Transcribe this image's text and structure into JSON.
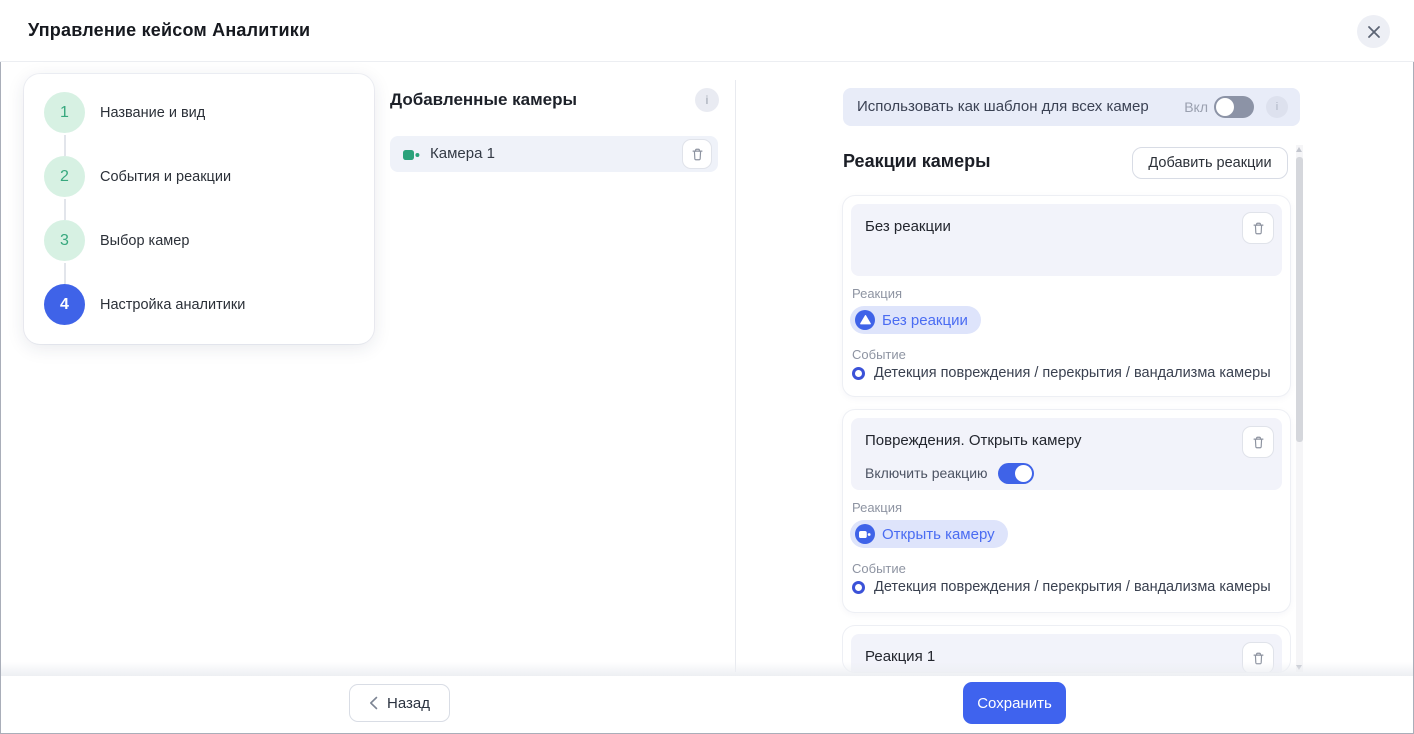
{
  "window": {
    "title": "Управление кейсом Аналитики",
    "close_icon": "close-x"
  },
  "stepper": {
    "steps": [
      {
        "number": "1",
        "label": "Название и вид",
        "state": "done"
      },
      {
        "number": "2",
        "label": "События и реакции",
        "state": "done"
      },
      {
        "number": "3",
        "label": "Выбор камер",
        "state": "done"
      },
      {
        "number": "4",
        "label": "Настройка аналитики",
        "state": "active"
      }
    ]
  },
  "cameras_panel": {
    "title": "Добавленные камеры",
    "info_icon": "i",
    "items": [
      {
        "name": "Камера 1",
        "icon": "camera-green"
      }
    ]
  },
  "reactions_panel": {
    "template_banner": {
      "label": "Использовать как шаблон для всех камер",
      "toggle_label": "Вкл",
      "toggle_state": "off",
      "info_icon": "i"
    },
    "title": "Реакции камеры",
    "add_button": "Добавить реакции",
    "labels": {
      "reaction": "Реакция",
      "event": "Событие"
    },
    "cards": [
      {
        "title": "Без реакции",
        "reaction_chip": "Без реакции",
        "chip_icon": "no-reaction-triangle",
        "event": "Детекция повреждения / перекрытия / вандализма камеры"
      },
      {
        "title": "Повреждения. Открыть камеру",
        "enable_label": "Включить реакцию",
        "toggle_state": "on",
        "reaction_chip": "Открыть камеру",
        "chip_icon": "open-camera",
        "event": "Детекция повреждения / перекрытия / вандализма камеры"
      },
      {
        "title": "Реакция 1"
      }
    ]
  },
  "footer": {
    "back_label": "Назад",
    "save_label": "Сохранить"
  },
  "colors": {
    "accent_blue": "#3f63e8",
    "chip_bg": "#dee4fb",
    "chip_text": "#4a6cf2",
    "step_green_bg": "#d7f1e3",
    "step_green_text": "#37a87e",
    "camera_icon_green": "#2aa27a",
    "banner_bg": "#e8ecf8",
    "card_header_bg": "#f2f3fa"
  }
}
